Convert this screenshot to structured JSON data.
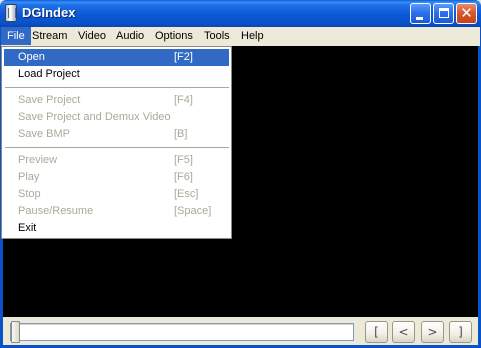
{
  "window": {
    "title": "DGIndex"
  },
  "titlebar": {
    "minimize_icon": "minimize-icon",
    "maximize_icon": "maximize-icon",
    "close_icon": "close-icon",
    "close_glyph": "✕"
  },
  "menubar": {
    "items": [
      {
        "label": "File",
        "active": true
      },
      {
        "label": "Stream"
      },
      {
        "label": "Video"
      },
      {
        "label": "Audio"
      },
      {
        "label": "Options"
      },
      {
        "label": "Tools"
      },
      {
        "label": "Help"
      }
    ]
  },
  "file_menu": {
    "items": [
      {
        "label": "Open",
        "shortcut": "[F2]",
        "enabled": true,
        "highlighted": true
      },
      {
        "label": "Load Project",
        "shortcut": "",
        "enabled": true
      },
      {
        "label": "Save Project",
        "shortcut": "[F4]",
        "enabled": false
      },
      {
        "label": "Save Project and Demux Video",
        "shortcut": "",
        "enabled": false
      },
      {
        "label": "Save BMP",
        "shortcut": "[B]",
        "enabled": false
      },
      {
        "label": "Preview",
        "shortcut": "[F5]",
        "enabled": false
      },
      {
        "label": "Play",
        "shortcut": "[F6]",
        "enabled": false
      },
      {
        "label": "Stop",
        "shortcut": "[Esc]",
        "enabled": false
      },
      {
        "label": "Pause/Resume",
        "shortcut": "[Space]",
        "enabled": false
      },
      {
        "label": "Exit",
        "shortcut": "",
        "enabled": true
      }
    ]
  },
  "transport": {
    "position": 0,
    "buttons": [
      {
        "glyph": "["
      },
      {
        "glyph": "<"
      },
      {
        "glyph": ">"
      },
      {
        "glyph": "]"
      }
    ]
  },
  "colors": {
    "titlebar": "#0a58d6",
    "highlight": "#316ac5",
    "video_bg": "#000000",
    "disabled_text": "#aca899"
  }
}
